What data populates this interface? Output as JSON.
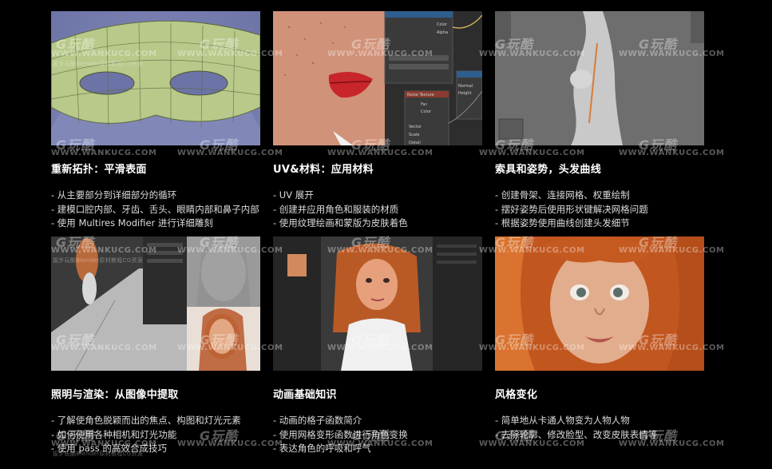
{
  "watermark": {
    "logo": "G玩酷",
    "url": "WWW.WANKUCG.COM",
    "sub": "拔步玩酷Blender原材教程CG资源"
  },
  "cards": [
    {
      "title": "重新拓扑：平滑表面",
      "bullets": [
        "- 从主要部分到详细部分的循环",
        "- 建模口腔内部、牙齿、舌头、眼睛内部和鼻子内部",
        "- 使用 Multires Modifier 进行详细雕刻"
      ]
    },
    {
      "title": "UV&材料：应用材料",
      "bullets": [
        "- UV 展开",
        "- 创建并应用角色和服装的材质",
        "- 使用纹理绘画和蒙版为皮肤着色"
      ]
    },
    {
      "title": "索具和姿势，头发曲线",
      "bullets": [
        "- 创建骨架、连接网格、权重绘制",
        "- 摆好姿势后使用形状键解决网格问题",
        "- 根据姿势使用曲线创建头发细节"
      ]
    },
    {
      "title": "照明与渲染：从图像中提取",
      "bullets": [
        "- 了解使角色脱颖而出的焦点、构图和灯光元素",
        "- 如何使用各种相机和灯光功能",
        "- 使用 pass 的高效合成技巧"
      ]
    },
    {
      "title": "动画基础知识",
      "bullets": [
        "- 动画的格子函数简介",
        "- 使用网格变形函数进行角色变换",
        "- 表达角色的呼吸和呼气"
      ]
    },
    {
      "title": "风格变化",
      "bullets": [
        "- 简单地从卡通人物变为人物人物",
        "- 去除轮廓、修改脸型、改变皮肤表情等"
      ]
    }
  ],
  "thumb2_node_labels": [
    "Color",
    "Alpha",
    "Noise Texture",
    "Fac",
    "Color",
    "Normal",
    "Height",
    "Vector",
    "Scale",
    "Detail"
  ]
}
